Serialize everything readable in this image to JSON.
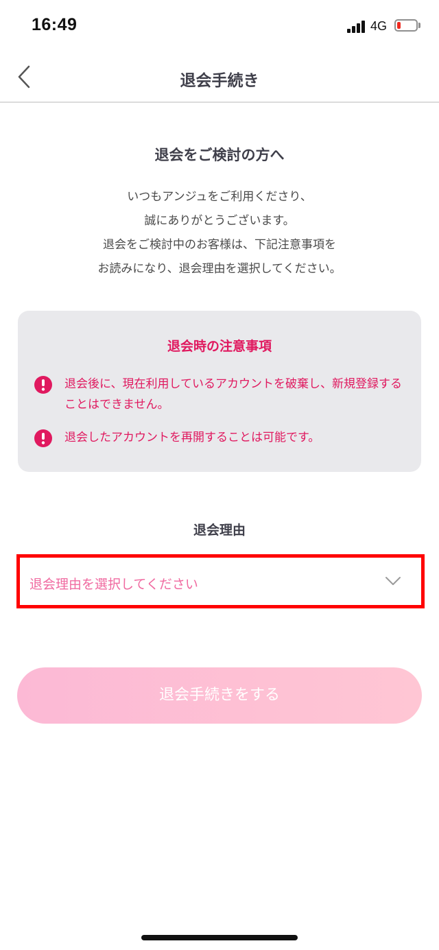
{
  "status_bar": {
    "time": "16:49",
    "network": "4G",
    "battery_level_fraction": 0.2
  },
  "header": {
    "title": "退会手続き",
    "back_icon": "chevron-left-icon"
  },
  "intro": {
    "heading": "退会をご検討の方へ",
    "lines": [
      "いつもアンジュをご利用くださり、",
      "誠にありがとうございます。",
      "退会をご検討中のお客様は、下記注意事項を",
      "お読みになり、退会理由を選択してください。"
    ]
  },
  "notice": {
    "title": "退会時の注意事項",
    "icon": "exclamation-circle-icon",
    "accent_color": "#e0195f",
    "items": [
      "退会後に、現在利用しているアカウントを破棄し、新規登録することはできません。",
      "退会したアカウントを再開することは可能です。"
    ]
  },
  "reason": {
    "label": "退会理由",
    "placeholder": "退会理由を選択してください",
    "dropdown_icon": "chevron-down-icon"
  },
  "submit": {
    "label": "退会手続きをする"
  }
}
